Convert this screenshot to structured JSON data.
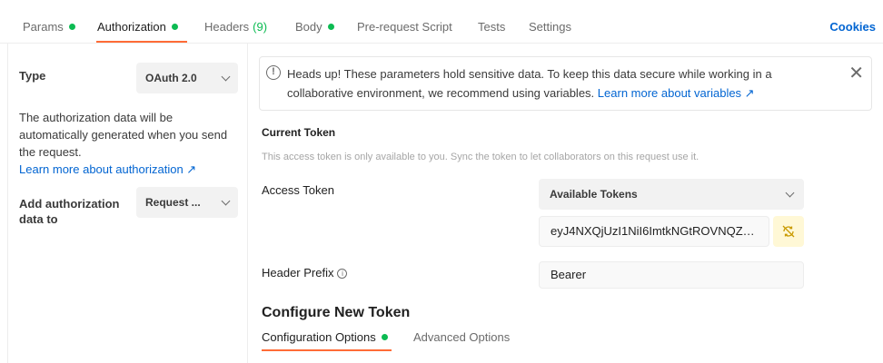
{
  "tabs": [
    {
      "label": "Params",
      "dot": true
    },
    {
      "label": "Authorization",
      "dot": true,
      "active": true
    },
    {
      "label": "Headers",
      "count": "(9)"
    },
    {
      "label": "Body",
      "dot": true
    },
    {
      "label": "Pre-request Script"
    },
    {
      "label": "Tests"
    },
    {
      "label": "Settings"
    }
  ],
  "cookies_label": "Cookies",
  "left": {
    "type_label": "Type",
    "type_value": "OAuth 2.0",
    "description": "The authorization data will be automatically generated when you send the request.",
    "learn_link": "Learn more about authorization ↗",
    "add_label": "Add authorization data to",
    "add_value": "Request ..."
  },
  "banner": {
    "text": "Heads up! These parameters hold sensitive data. To keep this data secure while working in a collaborative environment, we recommend using variables.",
    "link": "Learn more about variables ↗",
    "close": "✕"
  },
  "current_token": {
    "title": "Current Token",
    "subtitle": "This access token is only available to you. Sync the token to let collaborators on this request use it.",
    "access_label": "Access Token",
    "available_tokens": "Available Tokens",
    "token_value": "eyJ4NXQjUzI1NiI6ImtkNGtROVNQZ1cyN...",
    "header_prefix_label": "Header Prefix",
    "header_prefix_value": "Bearer"
  },
  "configure": {
    "title": "Configure New Token",
    "tab_config": "Configuration Options",
    "tab_advanced": "Advanced Options"
  },
  "colors": {
    "accent": "#ff6c37",
    "status_green": "#0cbb52",
    "link_blue": "#0265d2",
    "sync_bg": "#fff8d6"
  },
  "icons": {
    "info": "info-circle-icon",
    "close": "close-icon",
    "sync": "sync-off-icon",
    "help": "help-circle-icon",
    "chevron": "chevron-down-icon"
  }
}
